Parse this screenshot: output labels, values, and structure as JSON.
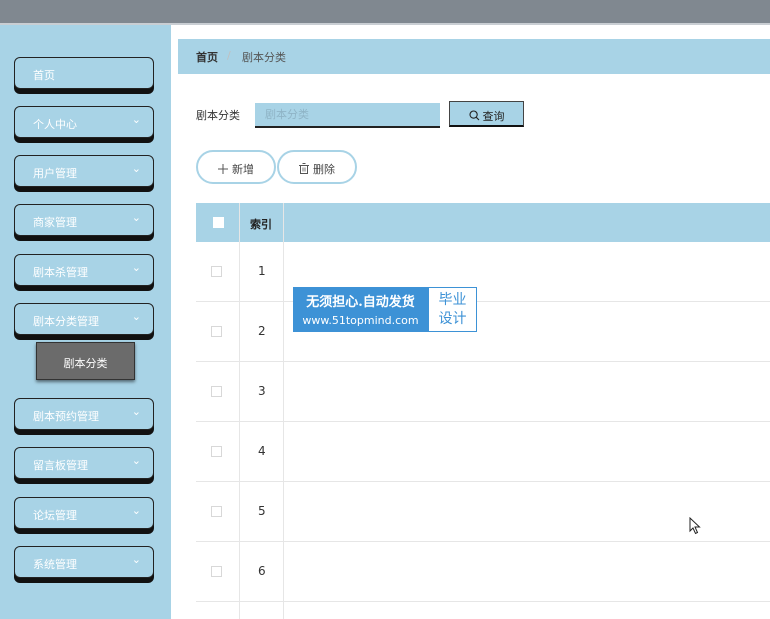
{
  "sidebar": {
    "items": [
      {
        "label": "首页",
        "expandable": false
      },
      {
        "label": "个人中心",
        "expandable": true
      },
      {
        "label": "用户管理",
        "expandable": true
      },
      {
        "label": "商家管理",
        "expandable": true
      },
      {
        "label": "剧本杀管理",
        "expandable": true
      },
      {
        "label": "剧本分类管理",
        "expandable": true
      },
      {
        "label": "剧本预约管理",
        "expandable": true
      },
      {
        "label": "留言板管理",
        "expandable": true
      },
      {
        "label": "论坛管理",
        "expandable": true
      },
      {
        "label": "系统管理",
        "expandable": true
      }
    ],
    "submenu_active": "剧本分类",
    "chevron": "⌄"
  },
  "breadcrumb": {
    "home": "首页",
    "separator": "/",
    "current": "剧本分类"
  },
  "search": {
    "label": "剧本分类",
    "placeholder": "剧本分类",
    "button_label": "查询"
  },
  "actions": {
    "add_label": "新增",
    "delete_label": "删除"
  },
  "table": {
    "index_header": "索引",
    "rows": [
      "1",
      "2",
      "3",
      "4",
      "5",
      "6"
    ]
  },
  "watermark": {
    "line1": "无须担心.自动发货",
    "line2": "www.51topmind.com",
    "right_line1": "毕业",
    "right_line2": "设计"
  },
  "colors": {
    "accent": "#a8d3e6",
    "topbar": "#808890",
    "submenu": "#6b6b6b",
    "watermark_blue": "#3d92d6"
  }
}
